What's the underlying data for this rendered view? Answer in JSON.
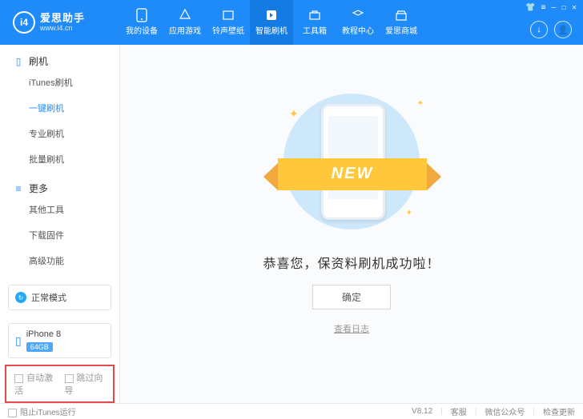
{
  "brand": {
    "logo_text": "i4",
    "name": "爱思助手",
    "url": "www.i4.cn"
  },
  "topnav": {
    "items": [
      {
        "label": "我的设备"
      },
      {
        "label": "应用游戏"
      },
      {
        "label": "铃声壁纸"
      },
      {
        "label": "智能刷机"
      },
      {
        "label": "工具箱"
      },
      {
        "label": "教程中心"
      },
      {
        "label": "爱思商城"
      }
    ],
    "active_index": 3
  },
  "window_controls": {
    "shirt": "👕",
    "settings": "≡",
    "min": "—",
    "max": "☐",
    "close": "✕"
  },
  "header_circle": {
    "download": "↓",
    "user": "👤"
  },
  "sidebar": {
    "groups": [
      {
        "title": "刷机",
        "items": [
          "iTunes刷机",
          "一键刷机",
          "专业刷机",
          "批量刷机"
        ],
        "active_index": 1
      },
      {
        "title": "更多",
        "items": [
          "其他工具",
          "下载固件",
          "高级功能"
        ],
        "active_index": -1
      }
    ],
    "mode_label": "正常模式",
    "device": {
      "name": "iPhone 8",
      "storage": "64GB"
    },
    "checkbox1": "自动激活",
    "checkbox2": "跳过向导"
  },
  "main": {
    "success_text": "恭喜您，保资料刷机成功啦！",
    "ribbon_text": "NEW",
    "ok_button": "确定",
    "view_log": "查看日志"
  },
  "statusbar": {
    "block_itunes": "阻止iTunes运行",
    "version": "V8.12",
    "support": "客服",
    "wechat": "微信公众号",
    "check_update": "检查更新"
  }
}
